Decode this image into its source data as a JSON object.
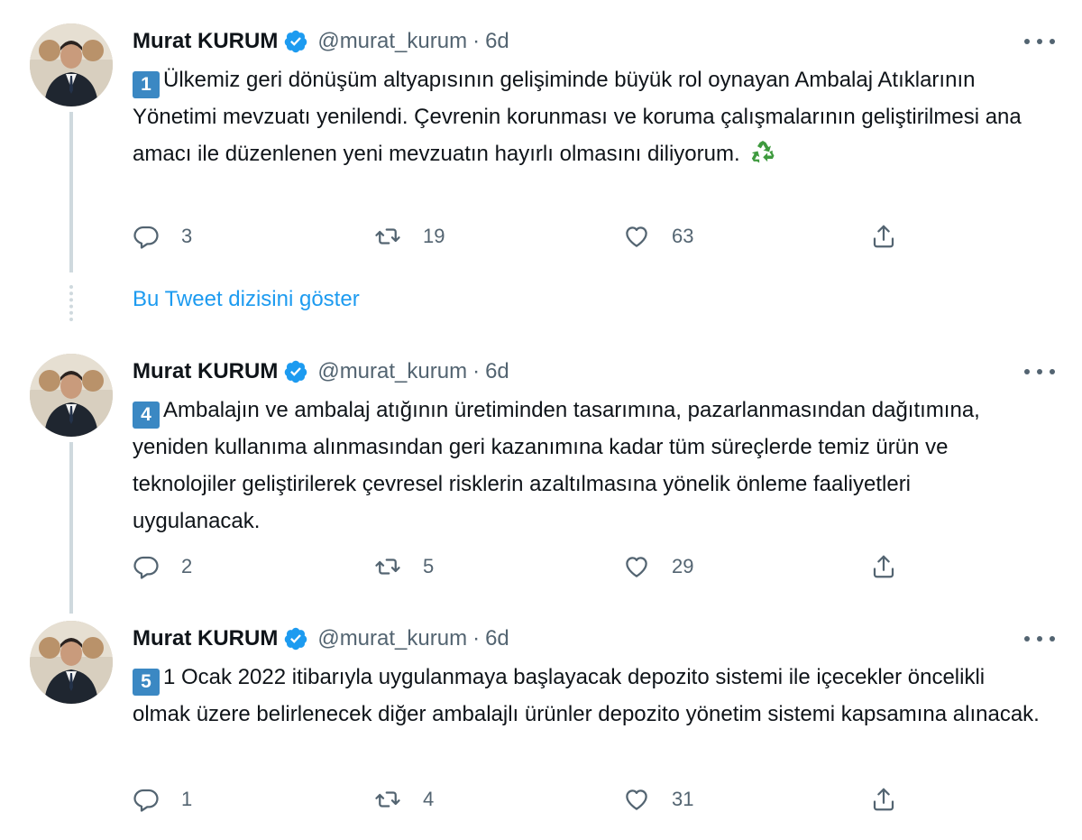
{
  "colors": {
    "accent": "#1d9bf0",
    "secondary_text": "#536471",
    "keycap_blue": "#3b88c3",
    "thread_line": "#cfd9de"
  },
  "show_thread_label": "Bu Tweet dizisini göster",
  "tweets": [
    {
      "name": "Murat KURUM",
      "handle": "@murat_kurum",
      "separator": "·",
      "time": "6d",
      "number": "1",
      "text": "Ülkemiz geri dönüşüm altyapısının gelişiminde büyük rol oynayan Ambalaj Atıklarının Yönetimi mevzuatı yenilendi. Çevrenin korunması ve koruma çalışmalarının geliştirilmesi ana amacı ile düzenlenen yeni mevzuatın hayırlı olmasını diliyorum.",
      "emoji": "recycle-icon",
      "replies": "3",
      "retweets": "19",
      "likes": "63"
    },
    {
      "name": "Murat KURUM",
      "handle": "@murat_kurum",
      "separator": "·",
      "time": "6d",
      "number": "4",
      "text": "Ambalajın ve ambalaj atığının üretiminden tasarımına, pazarlanmasından dağıtımına, yeniden kullanıma alınmasından geri kazanımına kadar tüm süreçlerde temiz ürün ve teknolojiler geliştirilerek çevresel risklerin azaltılmasına yönelik önleme faaliyetleri uygulanacak.",
      "replies": "2",
      "retweets": "5",
      "likes": "29"
    },
    {
      "name": "Murat KURUM",
      "handle": "@murat_kurum",
      "separator": "·",
      "time": "6d",
      "number": "5",
      "text": "1 Ocak 2022 itibarıyla uygulanmaya başlayacak depozito sistemi ile içecekler öncelikli olmak üzere belirlenecek diğer ambalajlı ürünler depozito yönetim sistemi kapsamına alınacak.",
      "replies": "1",
      "retweets": "4",
      "likes": "31"
    }
  ]
}
